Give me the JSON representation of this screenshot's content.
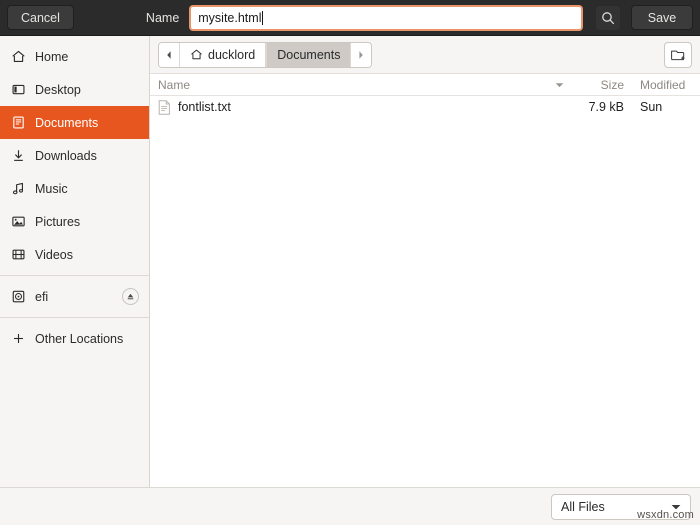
{
  "header": {
    "cancel_label": "Cancel",
    "name_label": "Name",
    "filename_value": "mysite.html",
    "filename_placeholder": "Name",
    "search_icon": "search-icon",
    "save_label": "Save"
  },
  "sidebar": {
    "items": [
      {
        "label": "Home",
        "icon": "home-icon",
        "selected": false
      },
      {
        "label": "Desktop",
        "icon": "desktop-icon",
        "selected": false
      },
      {
        "label": "Documents",
        "icon": "documents-icon",
        "selected": true
      },
      {
        "label": "Downloads",
        "icon": "downloads-icon",
        "selected": false
      },
      {
        "label": "Music",
        "icon": "music-icon",
        "selected": false
      },
      {
        "label": "Pictures",
        "icon": "pictures-icon",
        "selected": false
      },
      {
        "label": "Videos",
        "icon": "videos-icon",
        "selected": false
      }
    ],
    "devices": [
      {
        "label": "efi",
        "icon": "disc-icon",
        "eject_icon": "eject-icon"
      }
    ],
    "other_locations": {
      "label": "Other Locations",
      "icon": "plus-icon"
    }
  },
  "pathbar": {
    "back_icon": "chevron-left-icon",
    "forward_icon": "chevron-right-icon",
    "crumbs": [
      {
        "label": "ducklord",
        "icon": "home-icon",
        "active": false
      },
      {
        "label": "Documents",
        "icon": "",
        "active": true
      }
    ],
    "new_folder_icon": "new-folder-icon"
  },
  "columns": {
    "name": "Name",
    "size": "Size",
    "modified": "Modified",
    "sort_icon": "sort-descending-icon"
  },
  "files": [
    {
      "name": "fontlist.txt",
      "icon": "text-file-icon",
      "size": "7.9 kB",
      "modified": "Sun"
    }
  ],
  "footer": {
    "filter_label": "All Files",
    "filter_arrow_icon": "chevron-down-icon",
    "watermark": "wsxdn.com"
  },
  "colors": {
    "accent": "#e8561f",
    "header_bg": "#2b2b2b",
    "sidebar_bg": "#f6f5f4"
  }
}
